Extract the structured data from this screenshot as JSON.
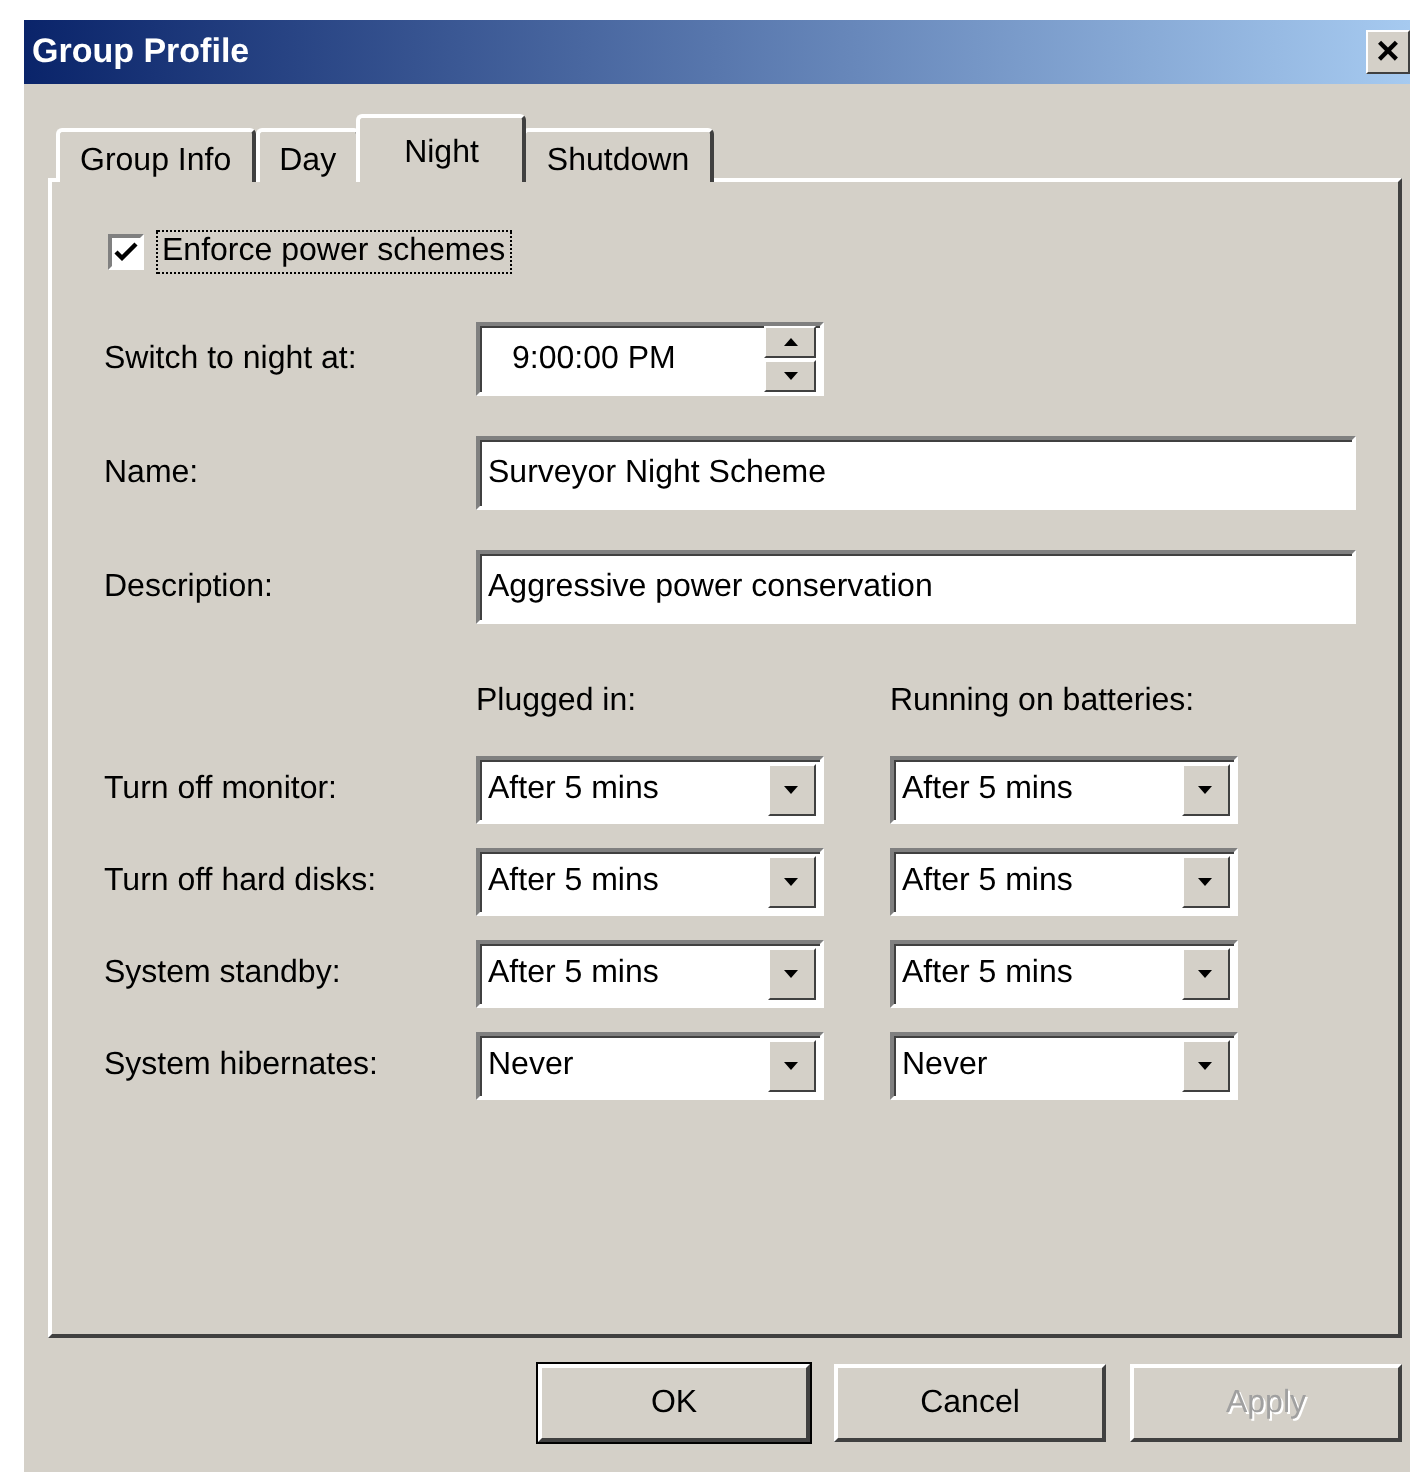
{
  "window": {
    "title": "Group Profile",
    "close": "×"
  },
  "tabs": [
    {
      "label": "Group Info",
      "selected": false
    },
    {
      "label": "Day",
      "selected": false
    },
    {
      "label": "Night",
      "selected": true
    },
    {
      "label": "Shutdown",
      "selected": false
    }
  ],
  "enforce": {
    "label": "Enforce power schemes",
    "checked": true
  },
  "switch_time": {
    "label": "Switch to night at:",
    "value": "9:00:00 PM"
  },
  "name": {
    "label": "Name:",
    "value": "Surveyor Night Scheme"
  },
  "description": {
    "label": "Description:",
    "value": "Aggressive power conservation"
  },
  "columns": [
    "Plugged in:",
    "Running on batteries:"
  ],
  "settings": [
    {
      "label": "Turn off monitor:",
      "plugged": "After 5 mins",
      "battery": "After 5 mins"
    },
    {
      "label": "Turn off hard disks:",
      "plugged": "After 5 mins",
      "battery": "After 5 mins"
    },
    {
      "label": "System standby:",
      "plugged": "After 5 mins",
      "battery": "After 5 mins"
    },
    {
      "label": "System hibernates:",
      "plugged": "Never",
      "battery": "Never"
    }
  ],
  "buttons": [
    {
      "label": "OK",
      "disabled": false,
      "default": true
    },
    {
      "label": "Cancel",
      "disabled": false,
      "default": false
    },
    {
      "label": "Apply",
      "disabled": true,
      "default": false
    }
  ]
}
